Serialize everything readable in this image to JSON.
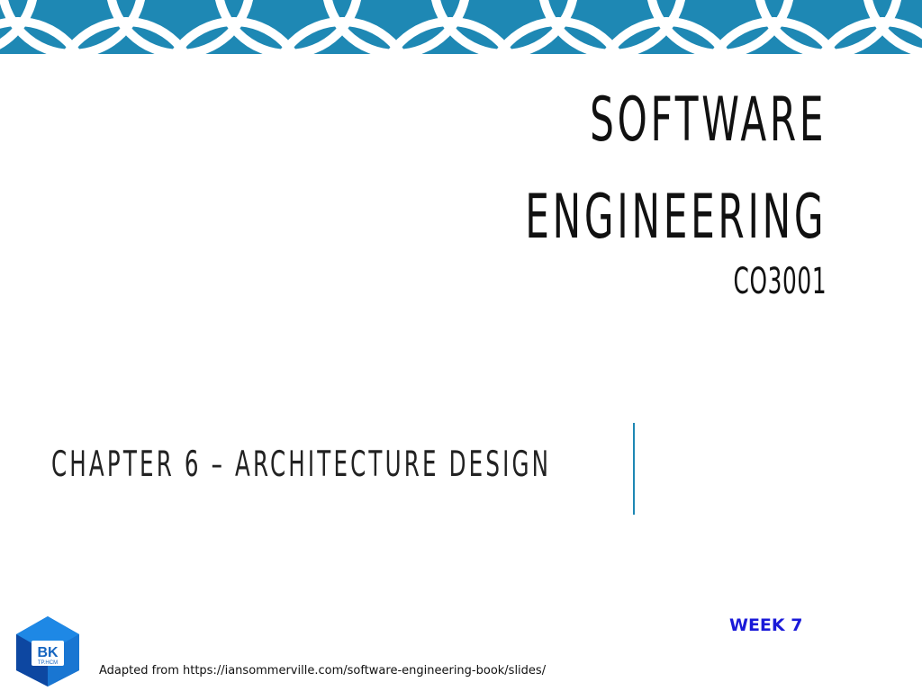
{
  "slide": {
    "title_line1": "SOFTWARE",
    "title_line2": "ENGINEERING",
    "course_code": "CO3001",
    "chapter": "CHAPTER 6 – ARCHITECTURE DESIGN",
    "week": "WEEK 7",
    "source_note": "Adapted from https://iansommerville.com/software-engineering-book/slides/"
  },
  "logo": {
    "text_main": "BK",
    "text_sub": "TP.HCM"
  },
  "colors": {
    "banner": "#1e88b4",
    "week_text": "#1a1ad8",
    "divider": "#1e88b4",
    "logo_blue": "#1565c0"
  }
}
